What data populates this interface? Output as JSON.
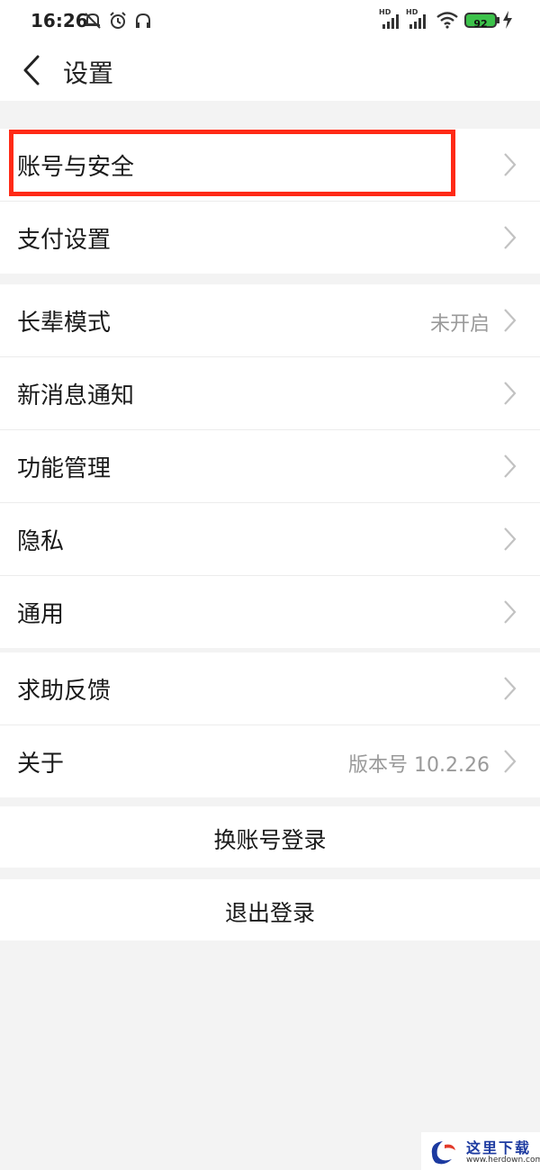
{
  "status_bar": {
    "time": "16:26",
    "battery": "92",
    "network_1": "HD",
    "network_2": "HD",
    "icons": [
      "mute-icon",
      "alarm-icon",
      "headset-icon",
      "signal-icon",
      "wifi-icon",
      "battery-icon",
      "charging-icon"
    ]
  },
  "header": {
    "title": "设置"
  },
  "groups": [
    {
      "items": [
        {
          "label": "账号与安全",
          "highlighted": true
        },
        {
          "label": "支付设置"
        }
      ]
    },
    {
      "items": [
        {
          "label": "长辈模式",
          "value": "未开启"
        },
        {
          "label": "新消息通知"
        },
        {
          "label": "功能管理"
        },
        {
          "label": "隐私"
        },
        {
          "label": "通用"
        }
      ]
    },
    {
      "items": [
        {
          "label": "求助反馈"
        },
        {
          "label": "关于",
          "value": "版本号 10.2.26"
        }
      ]
    }
  ],
  "actions": {
    "switch_account": "换账号登录",
    "logout": "退出登录"
  },
  "watermark": {
    "brand": "这里下载",
    "url": "www.herdown.com"
  },
  "colors": {
    "highlight": "#ff2a16",
    "battery": "#3cc24a"
  }
}
